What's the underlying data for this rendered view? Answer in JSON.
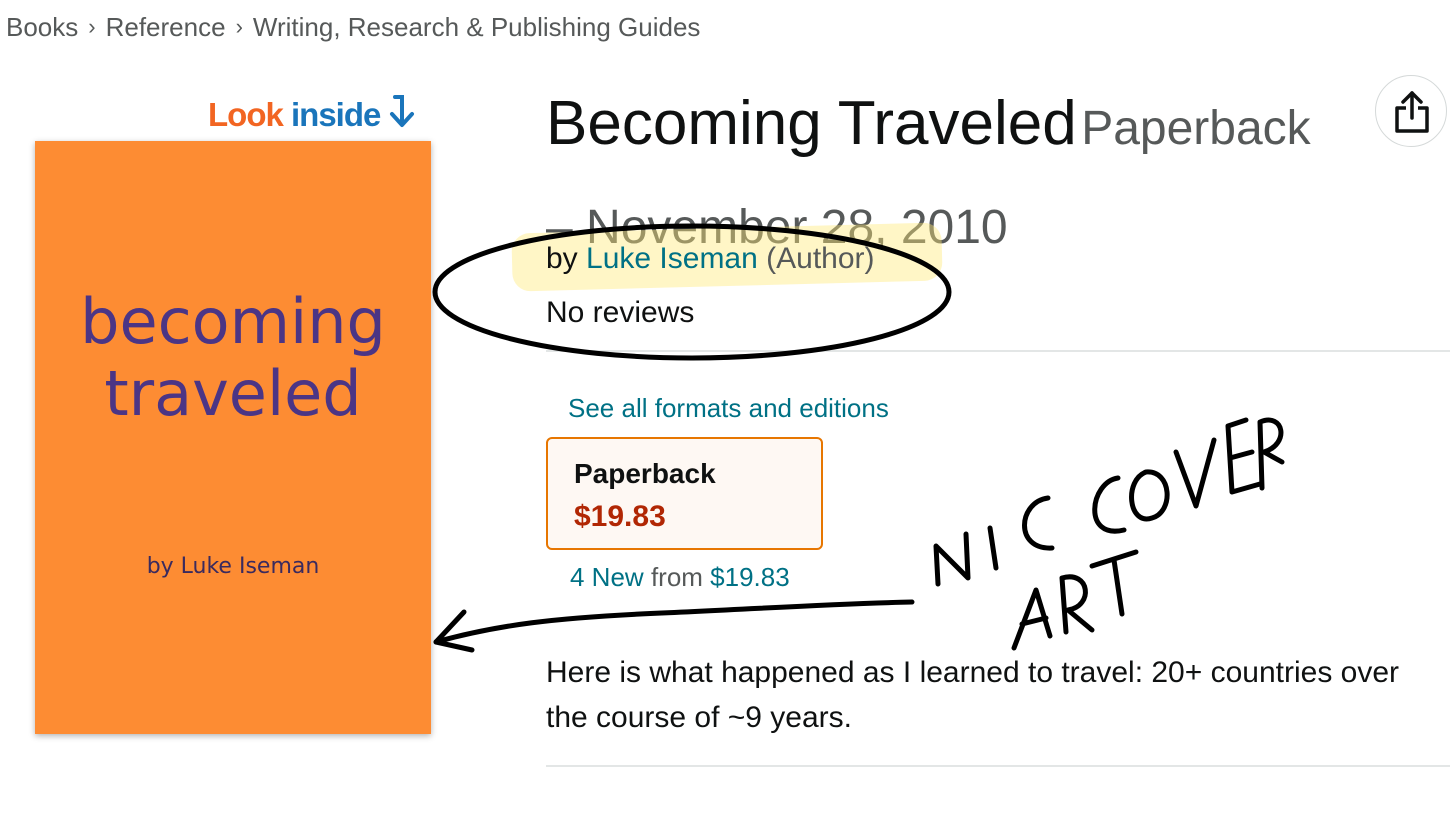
{
  "breadcrumb": [
    "Books",
    "Reference",
    "Writing, Research & Publishing Guides"
  ],
  "look_inside": {
    "look": "Look",
    "inside": "inside"
  },
  "cover": {
    "title_line1": "becoming",
    "title_line2": "traveled",
    "author": "by Luke Iseman",
    "color": "#fd8c33"
  },
  "product": {
    "title": "Becoming Traveled",
    "format": "Paperback",
    "date": "– November 28, 2010",
    "by": "by",
    "author": "Luke Iseman",
    "role": "(Author)",
    "reviews": "No reviews"
  },
  "formats": {
    "link": "See all formats and editions",
    "selected_name": "Paperback",
    "selected_price": "$19.83"
  },
  "offers": {
    "count": "4 New",
    "from": "from",
    "price": "$19.83"
  },
  "description": "Here is what happened as I learned to travel: 20+ countries over the course of ~9 years.",
  "colors": {
    "link": "#007185",
    "price": "#b12704",
    "selected_border": "#e77600"
  },
  "icons": [
    "share-icon",
    "look-inside-arrow-icon",
    "breadcrumb-chevron-icon"
  ],
  "annotation": {
    "text": "NICE COVER ART"
  }
}
